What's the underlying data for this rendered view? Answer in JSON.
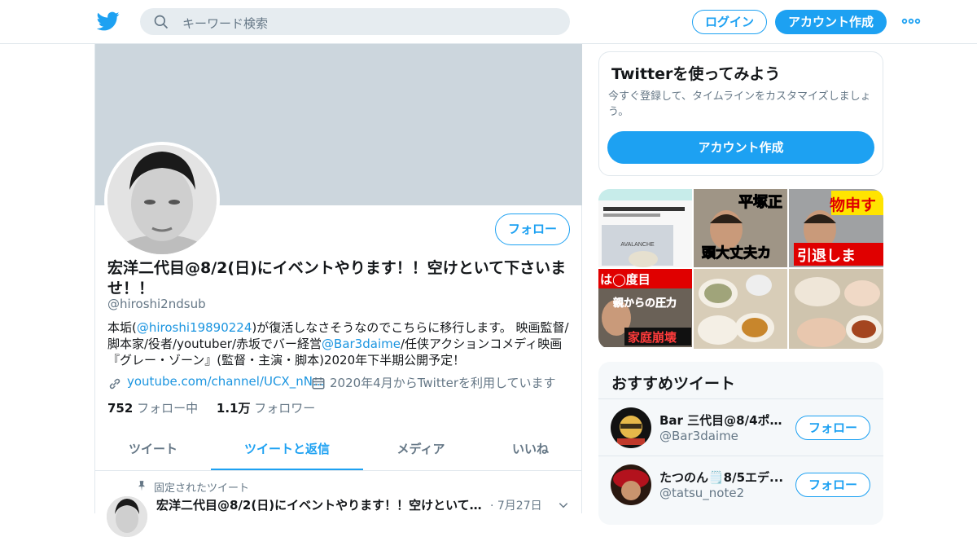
{
  "header": {
    "search_placeholder": "キーワード検索",
    "login_label": "ログイン",
    "signup_label": "アカウント作成"
  },
  "profile": {
    "name": "宏洋二代目@8/2(日)にイベントやります！！空けといて下さいませ！！",
    "handle": "@hiroshi2ndsub",
    "follow_label": "フォロー",
    "bio": {
      "part1": "本垢(",
      "link1": "@hiroshi19890224",
      "part2": ")が復活しなさそうなのでこちらに移行します。 映画監督/脚本家/役者/youtuber/赤坂でバー経営",
      "link2": "@Bar3daime",
      "part3": "/任侠アクションコメディ映画『グレー・ゾーン』(監督・主演・脚本)2020年下半期公開予定！"
    },
    "url": "youtube.com/channel/UCX_nN...",
    "joined": "2020年4月からTwitterを利用しています",
    "following_count": "752",
    "following_label": "フォロー中",
    "followers_count": "1.1万",
    "followers_label": "フォロワー"
  },
  "tabs": [
    {
      "label": "ツイート",
      "active": false
    },
    {
      "label": "ツイートと返信",
      "active": true
    },
    {
      "label": "メディア",
      "active": false
    },
    {
      "label": "いいね",
      "active": false
    }
  ],
  "pinned_tweet": {
    "pinned_label": "固定されたツイート",
    "author": "宏洋二代目@8/2(日)にイベントやります！！空けといて下...",
    "date": "· 7月27日"
  },
  "try_card": {
    "title": "Twitterを使ってみよう",
    "description": "今すぐ登録して、タイムラインをカスタマイズしましょう。",
    "cta_label": "アカウント作成"
  },
  "media": {
    "thumbs": [
      {
        "caption": "AVALANCHE",
        "overlay": ""
      },
      {
        "caption": "",
        "overlay": "平塚正",
        "overlay2": "頭大丈夫カ"
      },
      {
        "caption": "",
        "overlay": "物申す",
        "overlay2": "引退しま"
      },
      {
        "caption": "",
        "overlay": "は◯度目",
        "overlay2": "親からの圧力",
        "overlay3": "家庭崩壊"
      },
      {
        "caption": "",
        "overlay": ""
      },
      {
        "caption": "",
        "overlay": ""
      }
    ]
  },
  "recommended": {
    "title": "おすすめツイート",
    "accounts": [
      {
        "name": "Bar 三代目@8/4ポコ...",
        "handle": "@Bar3daime",
        "follow_label": "フォロー"
      },
      {
        "name": "たつのん🗒️8/5エデ...",
        "handle": "@tatsu_note2",
        "follow_label": "フォロー"
      }
    ]
  },
  "colors": {
    "accent": "#1da1f2",
    "link": "#1b95e0",
    "banner": "#ccd6dd",
    "muted": "#657786"
  }
}
